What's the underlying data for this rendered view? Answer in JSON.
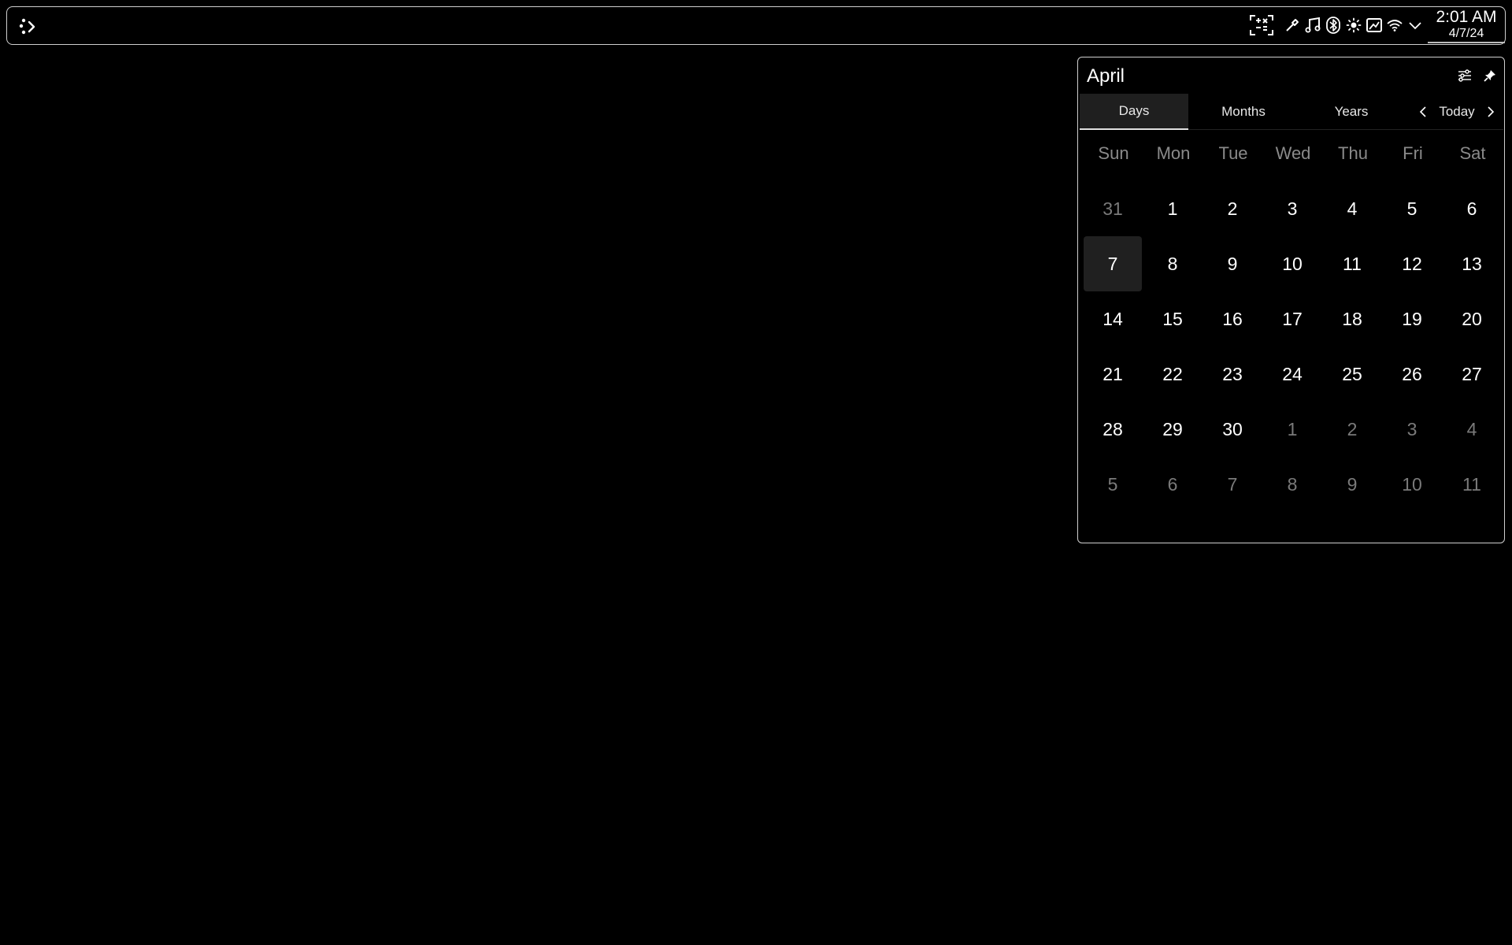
{
  "panel": {
    "launcher_icon": "app-launcher-icon",
    "tray_icons": [
      "screen-capture-icon",
      "color-picker-icon",
      "music-note-icon",
      "bluetooth-icon",
      "brightness-icon",
      "display-icon",
      "wifi-icon",
      "chevron-down-icon"
    ],
    "clock": {
      "time": "2:01 AM",
      "date": "4/7/24"
    }
  },
  "calendar": {
    "month_title": "April",
    "tabs": [
      "Days",
      "Months",
      "Years"
    ],
    "active_tab": "Days",
    "today_label": "Today",
    "weekdays": [
      "Sun",
      "Mon",
      "Tue",
      "Wed",
      "Thu",
      "Fri",
      "Sat"
    ],
    "weeks": [
      [
        {
          "d": "31",
          "m": true
        },
        {
          "d": "1"
        },
        {
          "d": "2"
        },
        {
          "d": "3"
        },
        {
          "d": "4"
        },
        {
          "d": "5"
        },
        {
          "d": "6"
        }
      ],
      [
        {
          "d": "7",
          "today": true
        },
        {
          "d": "8"
        },
        {
          "d": "9"
        },
        {
          "d": "10"
        },
        {
          "d": "11"
        },
        {
          "d": "12"
        },
        {
          "d": "13"
        }
      ],
      [
        {
          "d": "14"
        },
        {
          "d": "15"
        },
        {
          "d": "16"
        },
        {
          "d": "17"
        },
        {
          "d": "18"
        },
        {
          "d": "19"
        },
        {
          "d": "20"
        }
      ],
      [
        {
          "d": "21"
        },
        {
          "d": "22"
        },
        {
          "d": "23"
        },
        {
          "d": "24"
        },
        {
          "d": "25"
        },
        {
          "d": "26"
        },
        {
          "d": "27"
        }
      ],
      [
        {
          "d": "28"
        },
        {
          "d": "29"
        },
        {
          "d": "30"
        },
        {
          "d": "1",
          "m": true
        },
        {
          "d": "2",
          "m": true
        },
        {
          "d": "3",
          "m": true
        },
        {
          "d": "4",
          "m": true
        }
      ],
      [
        {
          "d": "5",
          "m": true
        },
        {
          "d": "6",
          "m": true
        },
        {
          "d": "7",
          "m": true
        },
        {
          "d": "8",
          "m": true
        },
        {
          "d": "9",
          "m": true
        },
        {
          "d": "10",
          "m": true
        },
        {
          "d": "11",
          "m": true
        }
      ]
    ]
  }
}
